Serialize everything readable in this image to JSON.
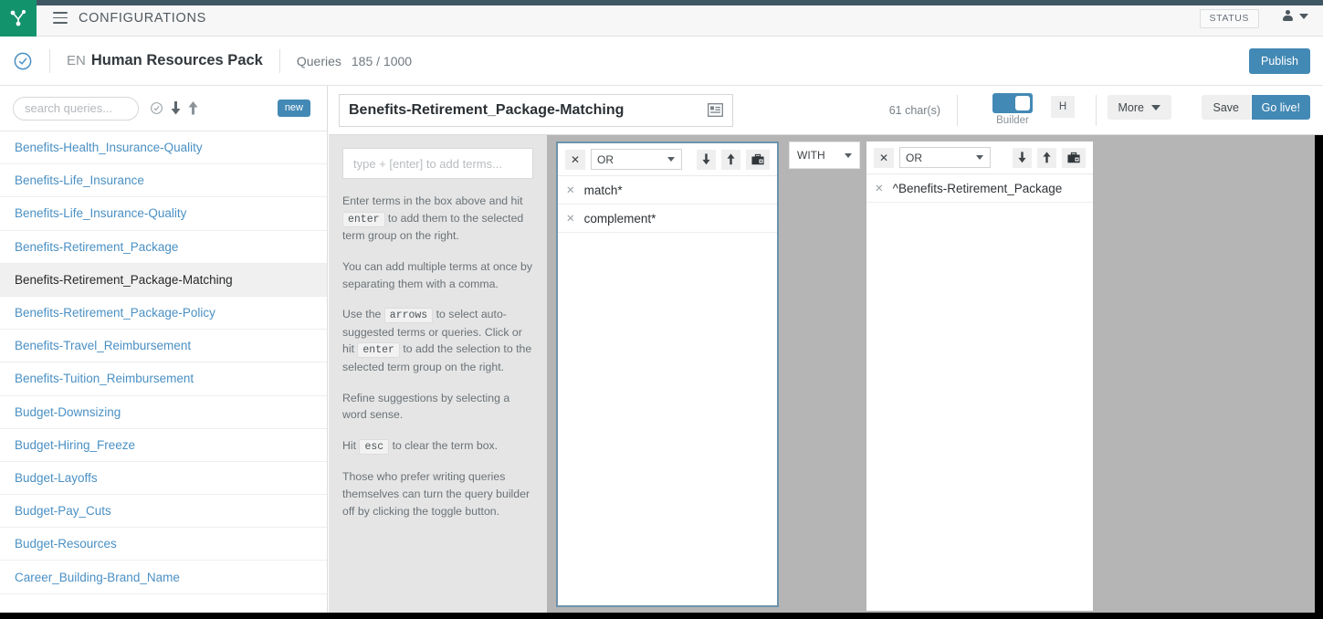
{
  "topbar": {
    "menu_icon": "hamburger-icon",
    "title": "CONFIGURATIONS",
    "status_label": "STATUS",
    "user_icon": "user-icon",
    "caret_icon": "chevron-down-icon",
    "logo_icon": "graph-node-logo-icon",
    "accent_green": "#13936c",
    "shade_color": "#3f5763"
  },
  "subheader": {
    "clock_icon": "clock-check-icon",
    "language": "EN",
    "pack_name": "Human Resources Pack",
    "queries_label": "Queries",
    "queries_count": "185 / 1000",
    "publish_label": "Publish",
    "accent_blue": "#4389b5"
  },
  "sidebar": {
    "search_placeholder": "search queries...",
    "search_value": "",
    "icons": [
      "clock-check-icon",
      "arrow-down-icon",
      "arrow-up-icon"
    ],
    "new_badge": "new",
    "items": [
      {
        "label": "Benefits-Health_Insurance-Quality",
        "selected": false
      },
      {
        "label": "Benefits-Life_Insurance",
        "selected": false
      },
      {
        "label": "Benefits-Life_Insurance-Quality",
        "selected": false
      },
      {
        "label": "Benefits-Retirement_Package",
        "selected": false
      },
      {
        "label": "Benefits-Retirement_Package-Matching",
        "selected": true
      },
      {
        "label": "Benefits-Retirement_Package-Policy",
        "selected": false
      },
      {
        "label": "Benefits-Travel_Reimbursement",
        "selected": false
      },
      {
        "label": "Benefits-Tuition_Reimbursement",
        "selected": false
      },
      {
        "label": "Budget-Downsizing",
        "selected": false
      },
      {
        "label": "Budget-Hiring_Freeze",
        "selected": false
      },
      {
        "label": "Budget-Layoffs",
        "selected": false
      },
      {
        "label": "Budget-Pay_Cuts",
        "selected": false
      },
      {
        "label": "Budget-Resources",
        "selected": false
      },
      {
        "label": "Career_Building-Brand_Name",
        "selected": false
      }
    ]
  },
  "editor": {
    "query_title": "Benefits-Retirement_Package-Matching",
    "title_side_icon": "list-card-icon",
    "char_count": "61 char(s)",
    "builder_toggle_label": "Builder",
    "builder_toggle_on": true,
    "h_button_label": "H",
    "more_label": "More",
    "save_label": "Save",
    "golive_label": "Go live!"
  },
  "builder": {
    "term_input_placeholder": "type + [enter] to add terms...",
    "term_input_value": "",
    "instructions": [
      {
        "parts": [
          {
            "t": "text",
            "v": "Enter terms in the box above and hit "
          },
          {
            "t": "kbd",
            "v": "enter"
          },
          {
            "t": "text",
            "v": " to add them to the selected term group on the right."
          }
        ]
      },
      {
        "parts": [
          {
            "t": "text",
            "v": "You can add multiple terms at once by separating them with a comma."
          }
        ]
      },
      {
        "parts": [
          {
            "t": "text",
            "v": "Use the "
          },
          {
            "t": "kbd",
            "v": "arrows"
          },
          {
            "t": "text",
            "v": " to select auto-suggested terms or queries. Click or hit "
          },
          {
            "t": "kbd",
            "v": "enter"
          },
          {
            "t": "text",
            "v": " to add the selection to the selected term group on the right."
          }
        ]
      },
      {
        "parts": [
          {
            "t": "text",
            "v": "Refine suggestions by selecting a word sense."
          }
        ]
      },
      {
        "parts": [
          {
            "t": "text",
            "v": "Hit "
          },
          {
            "t": "kbd",
            "v": "esc"
          },
          {
            "t": "text",
            "v": " to clear the term box."
          }
        ]
      },
      {
        "parts": [
          {
            "t": "text",
            "v": "Those who prefer writing queries themselves can turn the query builder off by clicking the toggle button."
          }
        ]
      }
    ],
    "groups": [
      {
        "operator": "OR",
        "selected": true,
        "close_icon": "close-icon",
        "move_down_icon": "arrow-down-icon",
        "move_up_icon": "arrow-up-icon",
        "add_group_icon": "briefcase-plus-icon",
        "terms": [
          "match*",
          "complement*"
        ]
      },
      {
        "operator": "OR",
        "selected": false,
        "close_icon": "close-icon",
        "move_down_icon": "arrow-down-icon",
        "move_up_icon": "arrow-up-icon",
        "add_group_icon": "briefcase-plus-icon",
        "terms": [
          "^Benefits-Retirement_Package"
        ]
      }
    ],
    "join_operator": "WITH",
    "canvas_color": "#b5b5b5",
    "selected_border_color": "#6d93ab"
  }
}
